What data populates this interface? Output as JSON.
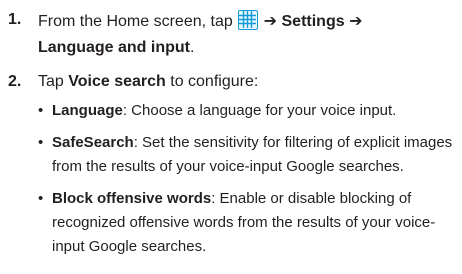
{
  "steps": [
    {
      "number": "1.",
      "text_before_icon": "From the Home screen, tap ",
      "icon": "apps-grid-icon",
      "arrow1": "➔",
      "settings": "Settings",
      "arrow2": "➔",
      "menu_item": "Language and input",
      "period": "."
    },
    {
      "number": "2.",
      "text_tap": "Tap ",
      "option": "Voice search",
      "text_after": " to configure:"
    }
  ],
  "bullets": [
    {
      "symbol": "•",
      "term": "Language",
      "line1": ": Choose a language for your voice input."
    },
    {
      "symbol": "•",
      "term": "SafeSearch",
      "line1": ": Set the sensitivity for filtering of explicit images",
      "line2": "from the results of your voice-input Google searches."
    },
    {
      "symbol": "•",
      "term": "Block offensive words",
      "line1": ": Enable or disable blocking of",
      "line2": "recognized offensive words from the results of your voice-",
      "line3": "input Google searches."
    }
  ],
  "colors": {
    "icon_border": "#0d9ad7",
    "icon_fill": "#e9f7fd",
    "text": "#231f20"
  }
}
